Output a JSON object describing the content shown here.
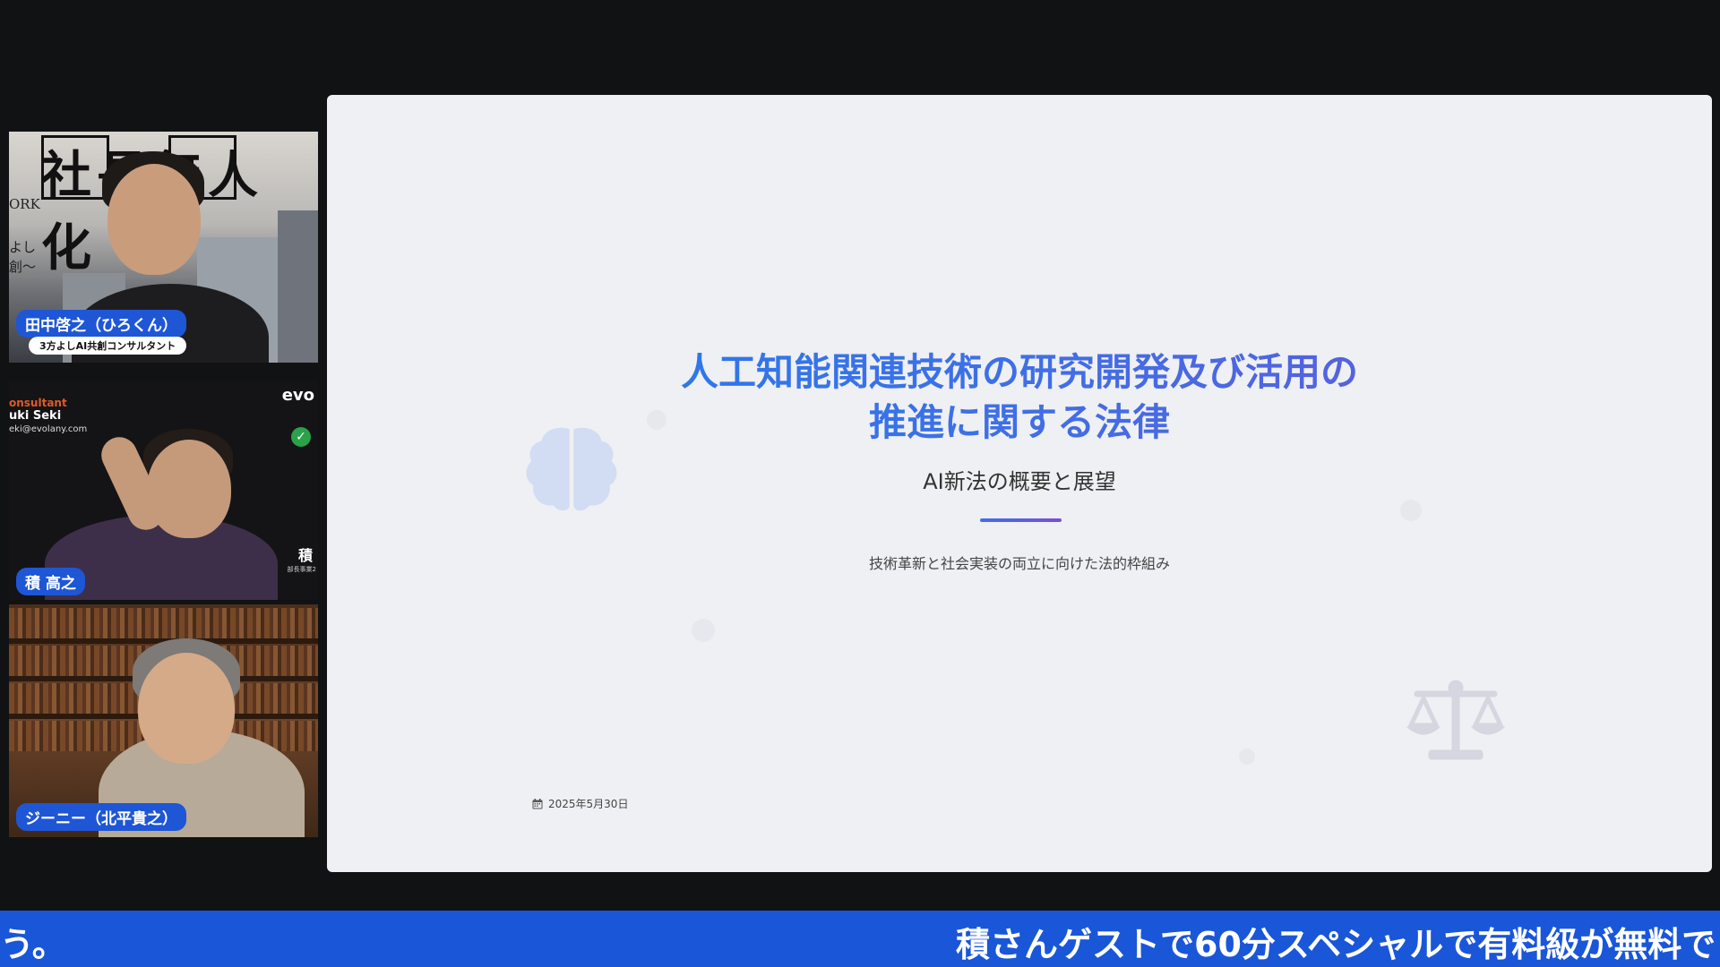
{
  "participants": [
    {
      "name": "田中啓之（ひろくん）",
      "subtitle": "3方よしAI共創コンサルタント",
      "background": {
        "big_text": "社長無人化",
        "small_1": "ORK",
        "small_2": "よし",
        "small_3": "創〜"
      }
    },
    {
      "name": "積 高之",
      "background": {
        "orange": "onsultant",
        "name": "uki Seki",
        "email": "eki@evolany.com",
        "logo": "evo",
        "kanji": "積",
        "kanji_sub": "部長事業2"
      }
    },
    {
      "name": "ジーニー（北平貴之）"
    }
  ],
  "slide": {
    "title_line1": "人工知能関連技術の研究開発及び活用の",
    "title_line2": "推進に関する法律",
    "subtitle": "AI新法の概要と展望",
    "description": "技術革新と社会実装の両立に向けた法的枠組み",
    "date": "2025年5月30日",
    "icons": [
      "brain-icon",
      "scale-icon",
      "calendar-icon"
    ]
  },
  "ticker": {
    "left_fragment": "う。",
    "text": "積さんゲストで60分スペシャルで有料級が無料で"
  },
  "colors": {
    "accent": "#1a56d8",
    "title_gradient_start": "#1e7ef0",
    "title_gradient_end": "#6a55d8"
  }
}
